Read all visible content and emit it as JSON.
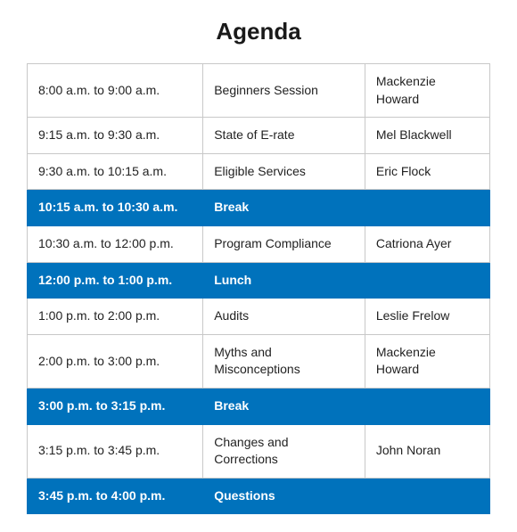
{
  "title": "Agenda",
  "colors": {
    "break_bg": "#0072bc",
    "break_text": "#ffffff",
    "normal_bg": "#ffffff",
    "normal_text": "#222222",
    "border": "#c8c8c8"
  },
  "rows": [
    {
      "type": "normal",
      "time": "8:00 a.m. to 9:00 a.m.",
      "topic": "Beginners Session",
      "presenter": "Mackenzie Howard"
    },
    {
      "type": "normal",
      "time": "9:15 a.m. to 9:30 a.m.",
      "topic": "State of E-rate",
      "presenter": "Mel Blackwell"
    },
    {
      "type": "normal",
      "time": "9:30 a.m. to 10:15 a.m.",
      "topic": "Eligible Services",
      "presenter": "Eric Flock"
    },
    {
      "type": "break",
      "time": "10:15 a.m. to 10:30 a.m.",
      "topic": "Break",
      "presenter": ""
    },
    {
      "type": "normal",
      "time": "10:30 a.m. to 12:00 p.m.",
      "topic": "Program Compliance",
      "presenter": "Catriona Ayer"
    },
    {
      "type": "break",
      "time": "12:00 p.m. to 1:00 p.m.",
      "topic": "Lunch",
      "presenter": ""
    },
    {
      "type": "normal",
      "time": "1:00 p.m. to 2:00 p.m.",
      "topic": "Audits",
      "presenter": "Leslie Frelow"
    },
    {
      "type": "normal",
      "time": "2:00 p.m. to 3:00 p.m.",
      "topic": "Myths and Misconceptions",
      "presenter": "Mackenzie Howard"
    },
    {
      "type": "break",
      "time": "3:00 p.m. to 3:15 p.m.",
      "topic": "Break",
      "presenter": ""
    },
    {
      "type": "normal",
      "time": "3:15 p.m. to 3:45 p.m.",
      "topic": "Changes and Corrections",
      "presenter": "John Noran"
    },
    {
      "type": "break",
      "time": "3:45 p.m. to 4:00 p.m.",
      "topic": "Questions",
      "presenter": ""
    }
  ]
}
